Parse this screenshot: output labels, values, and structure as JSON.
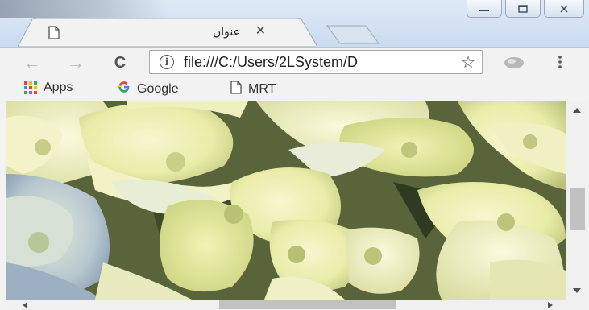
{
  "window": {
    "controls": {
      "minimize_icon": "minimize-icon",
      "restore_icon": "restore-icon",
      "close_icon": "close-icon"
    }
  },
  "tabs": [
    {
      "title": "عنوان",
      "close_glyph": "✕",
      "icon": "document-icon",
      "active": true
    }
  ],
  "toolbar": {
    "back_glyph": "←",
    "forward_glyph": "→",
    "reload_glyph": "C",
    "info_glyph": "i",
    "url": "file:///C:/Users/2LSystem/D",
    "star_glyph": "☆",
    "menu_glyph": "⋮"
  },
  "bookmarks": [
    {
      "label": "Apps",
      "icon": "apps-grid-icon"
    },
    {
      "label": "Google",
      "icon": "google-icon",
      "glyph": "G"
    },
    {
      "label": "MRT",
      "icon": "document-icon"
    }
  ],
  "colors": {
    "titlebar": "#c9dbef",
    "toolbar": "#f2f2f2",
    "google_blue": "#4285f4",
    "apps_colors": [
      "#ea4335",
      "#fbbc05",
      "#34a853",
      "#4285f4",
      "#ea4335",
      "#fbbc05",
      "#34a853",
      "#4285f4",
      "#ea4335"
    ]
  },
  "content": {
    "image": "hydrangea-flowers"
  }
}
